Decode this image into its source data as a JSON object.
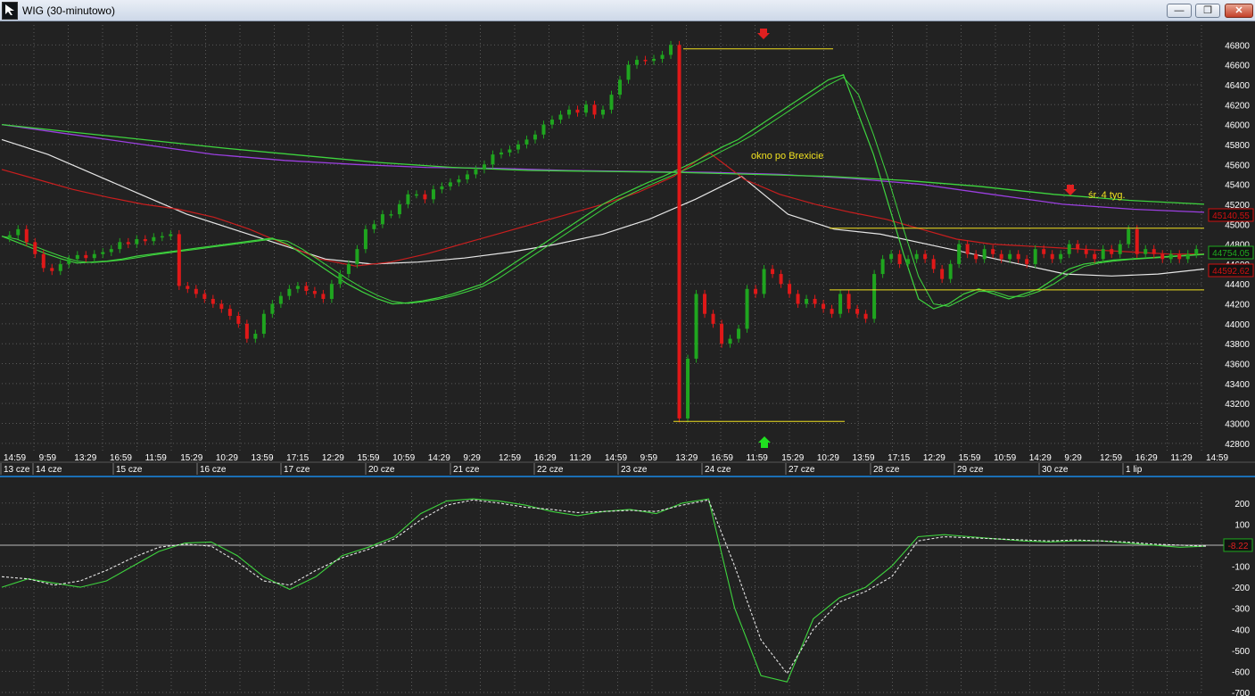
{
  "window": {
    "title": "WIG (30-minutowo)",
    "minimize_icon": "minimize-icon",
    "maximize_icon": "restore-icon",
    "close_icon": "close-icon",
    "minimize_glyph": "—",
    "maximize_glyph": "❐",
    "close_glyph": "✕"
  },
  "colors": {
    "background": "#222222",
    "grid": "#5a5a5a",
    "axis_text": "#ffffff",
    "bull_candle": "#1fa51f",
    "bear_candle": "#e01818",
    "ma_green": "#3ed43e",
    "ma_red": "#c81e1e",
    "ma_white": "#e6e6e6",
    "ma_purple": "#9b3fe0",
    "annotation": "#f0e020",
    "separator": "#1a6fb5"
  },
  "annotations": {
    "brexit_text": "okno po Brexicie",
    "avg_text": "śr. 4 tyg."
  },
  "price_badges": [
    {
      "value": "45140.55",
      "color": "#d01010"
    },
    {
      "value": "44754.05",
      "color": "#1faa1f"
    },
    {
      "value": "44592.62",
      "color": "#d01010"
    }
  ],
  "osc_badge": "-8.22",
  "chart_data": [
    {
      "type": "candlestick",
      "title": "WIG (30-minutowo)",
      "y_axis_ticks": [
        "46800",
        "46600",
        "46400",
        "46200",
        "46000",
        "45800",
        "45600",
        "45400",
        "45200",
        "45000",
        "44800",
        "44600",
        "44400",
        "44200",
        "44000",
        "43800",
        "43600",
        "43400",
        "43200",
        "43000",
        "42800"
      ],
      "ylim": [
        42700,
        47000
      ],
      "time_labels": [
        "14:59",
        "9:59",
        "13:29",
        "16:59",
        "11:59",
        "15:29",
        "10:29",
        "13:59",
        "17:15",
        "12:29",
        "15:59",
        "10:59",
        "14:29",
        "9:29",
        "12:59",
        "16:29",
        "11:29",
        "14:59",
        "9:59",
        "13:29",
        "16:59",
        "11:59",
        "15:29",
        "10:29",
        "13:59",
        "17:15",
        "12:29",
        "15:59",
        "10:59",
        "14:29",
        "9:29",
        "12:59",
        "16:29",
        "11:29",
        "14:59"
      ],
      "date_labels": [
        "13 cze",
        "14 cze",
        "15 cze",
        "16 cze",
        "17 cze",
        "20 cze",
        "21 cze",
        "22 cze",
        "23 cze",
        "24 cze",
        "27 cze",
        "28 cze",
        "29 cze",
        "30 cze",
        "1 lip"
      ],
      "close": [
        44890,
        44950,
        44820,
        44700,
        44560,
        44530,
        44600,
        44650,
        44690,
        44660,
        44700,
        44720,
        44750,
        44820,
        44800,
        44850,
        44830,
        44870,
        44880,
        44900,
        44380,
        44350,
        44300,
        44250,
        44200,
        44150,
        44080,
        44000,
        43850,
        43900,
        44100,
        44200,
        44280,
        44350,
        44380,
        44330,
        44300,
        44250,
        44400,
        44500,
        44600,
        44750,
        44950,
        45000,
        45100,
        45100,
        45200,
        45300,
        45300,
        45250,
        45350,
        45380,
        45420,
        45450,
        45500,
        45550,
        45600,
        45700,
        45720,
        45750,
        45800,
        45850,
        45900,
        46000,
        46050,
        46100,
        46150,
        46120,
        46200,
        46100,
        46150,
        46300,
        46450,
        46600,
        46650,
        46640,
        46660,
        46700,
        46800,
        43050,
        43650,
        44300,
        44100,
        44000,
        43800,
        43850,
        43950,
        44350,
        44300,
        44550,
        44500,
        44400,
        44300,
        44200,
        44250,
        44200,
        44150,
        44100,
        44300,
        44150,
        44100,
        44050,
        44500,
        44650,
        44700,
        44600,
        44650,
        44700,
        44650,
        44550,
        44450,
        44600,
        44800,
        44700,
        44650,
        44750,
        44700,
        44650,
        44700,
        44650,
        44600,
        44750,
        44700,
        44650,
        44700,
        44800,
        44750,
        44700,
        44650,
        44750,
        44700,
        44800,
        44950,
        44700,
        44750,
        44700,
        44650,
        44700,
        44650,
        44700,
        44750
      ],
      "ma_green_fast": [
        44880,
        44820,
        44760,
        44700,
        44650,
        44610,
        44620,
        44630,
        44650,
        44680,
        44700,
        44720,
        44740,
        44760,
        44780,
        44800,
        44820,
        44840,
        44860,
        44800,
        44700,
        44600,
        44500,
        44400,
        44320,
        44250,
        44200,
        44210,
        44230,
        44260,
        44300,
        44350,
        44400,
        44500,
        44600,
        44700,
        44800,
        44900,
        45000,
        45100,
        45200,
        45280,
        45350,
        45420,
        45480,
        45550,
        45620,
        45700,
        45780,
        45850,
        45950,
        46050,
        46150,
        46250,
        46350,
        46450,
        46500,
        46100,
        45700,
        45200,
        44700,
        44250,
        44150,
        44200,
        44300,
        44350,
        44300,
        44250,
        44300,
        44350,
        44450,
        44550,
        44600,
        44620,
        44640,
        44650,
        44660,
        44670,
        44680,
        44690,
        44700
      ],
      "ma_red": [
        45550,
        45450,
        45350,
        45270,
        45200,
        45150,
        45070,
        44950,
        44800,
        44650,
        44580,
        44620,
        44700,
        44800,
        44900,
        45000,
        45100,
        45200,
        45320,
        45480,
        45720,
        45450,
        45300,
        45200,
        45120,
        45050,
        44950,
        44850,
        44800,
        44780,
        44760,
        44740,
        44720,
        44700,
        44700
      ],
      "ma_white": [
        45850,
        45700,
        45500,
        45300,
        45100,
        44950,
        44800,
        44650,
        44600,
        44620,
        44660,
        44720,
        44800,
        44900,
        45050,
        45250,
        45480,
        45100,
        44950,
        44900,
        44800,
        44700,
        44600,
        44500,
        44480,
        44500,
        44550
      ],
      "ma_purple": [
        46000,
        45900,
        45800,
        45700,
        45640,
        45600,
        45570,
        45560,
        45540,
        45530,
        45520,
        45500,
        45460,
        45400,
        45300,
        45200,
        45150,
        45120
      ]
    },
    {
      "type": "line",
      "title": "",
      "y_axis_ticks": [
        "200",
        "100",
        "0",
        "-100",
        "-200",
        "-300",
        "-400",
        "-500",
        "-600",
        "-700"
      ],
      "ylim": [
        -700,
        250
      ],
      "series": [
        {
          "values": [
            -200,
            -160,
            -180,
            -200,
            -170,
            -100,
            -30,
            10,
            15,
            -50,
            -150,
            -210,
            -150,
            -50,
            -10,
            40,
            150,
            210,
            220,
            210,
            190,
            160,
            140,
            160,
            170,
            150,
            200,
            220,
            -300,
            -620,
            -650,
            -350,
            -250,
            -200,
            -100,
            40,
            50,
            40,
            30,
            20,
            15,
            20,
            20,
            10,
            0,
            -10,
            -5
          ]
        },
        {
          "values": [
            -150,
            -160,
            -190,
            -170,
            -120,
            -60,
            -10,
            5,
            -5,
            -80,
            -170,
            -190,
            -120,
            -60,
            -20,
            30,
            120,
            190,
            215,
            200,
            180,
            170,
            155,
            160,
            165,
            160,
            190,
            215,
            -100,
            -450,
            -610,
            -400,
            -270,
            -220,
            -150,
            20,
            40,
            35,
            30,
            25,
            20,
            25,
            20,
            15,
            5,
            0,
            -5
          ]
        }
      ]
    }
  ]
}
